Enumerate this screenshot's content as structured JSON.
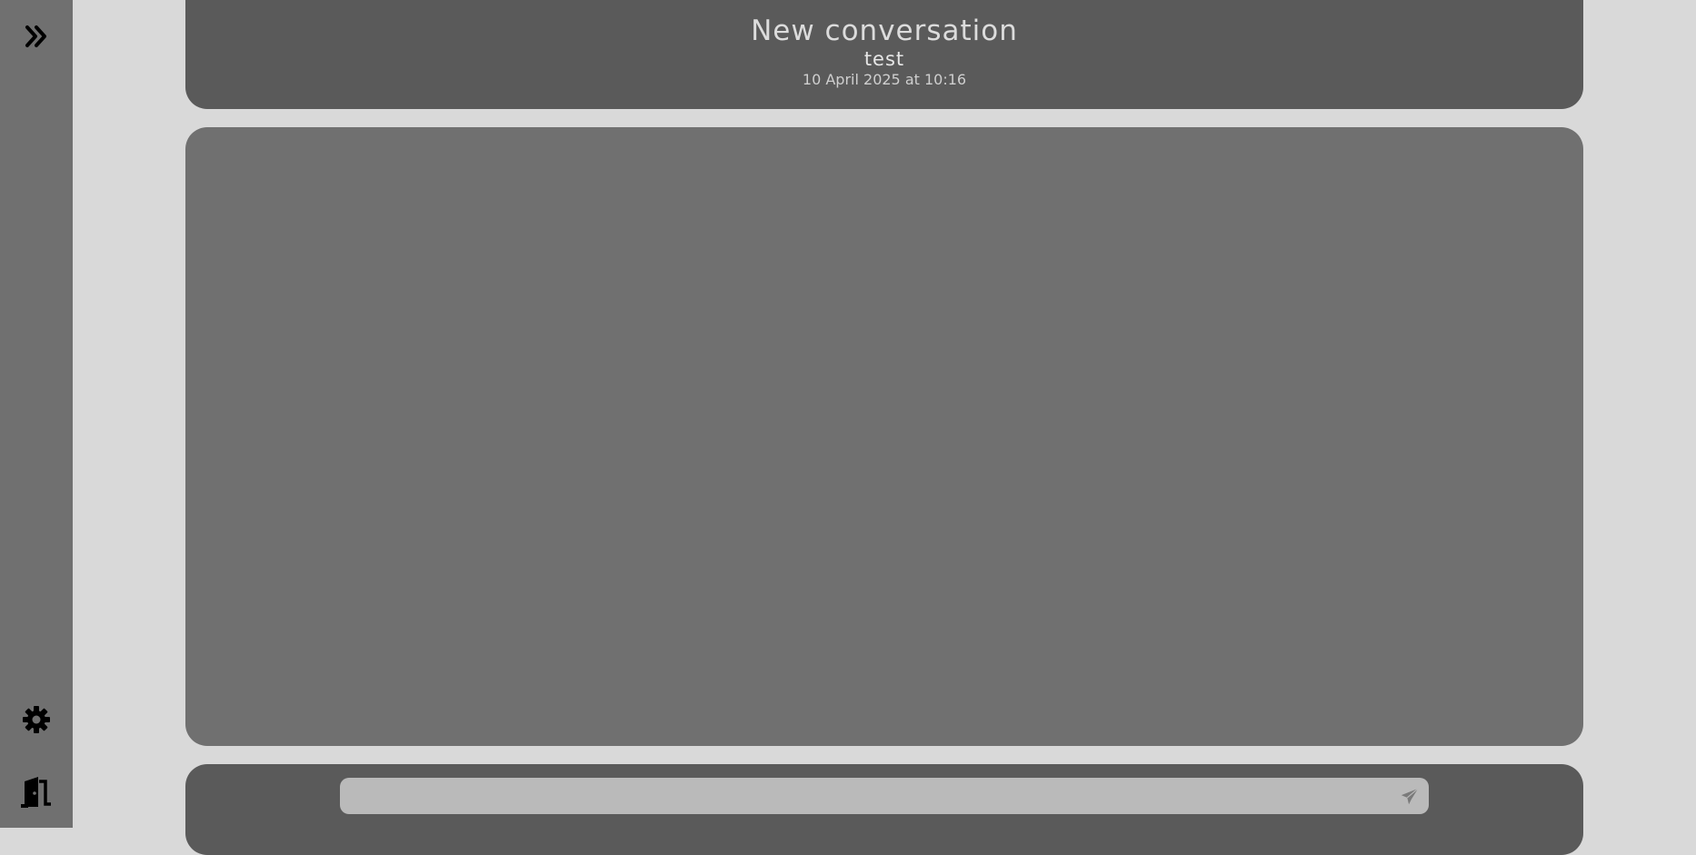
{
  "sidebar": {
    "expand_icon": "double-chevron-right-icon",
    "settings_icon": "gear-icon",
    "logout_icon": "door-exit-icon"
  },
  "header": {
    "title": "New conversation",
    "subtitle": "test",
    "timestamp": "10 April 2025 at 10:16"
  },
  "composer": {
    "input_value": "",
    "input_placeholder": "",
    "send_icon": "paper-plane-icon"
  },
  "colors": {
    "background": "#d9d9d9",
    "sidebar": "#707070",
    "header": "#5a5a5a",
    "messages_panel": "#707070",
    "input": "#bababa",
    "icon": "#000000"
  }
}
